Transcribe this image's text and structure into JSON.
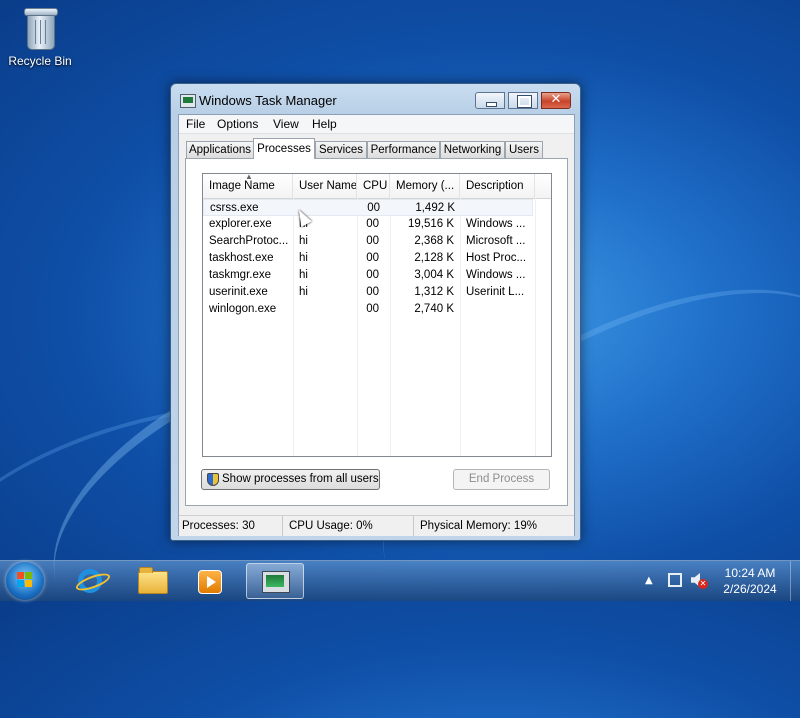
{
  "desktop": {
    "icons": [
      {
        "label": "Recycle Bin",
        "icon": "recycle-bin-icon"
      }
    ]
  },
  "window": {
    "title": "Windows Task Manager",
    "menu": [
      "File",
      "Options",
      "View",
      "Help"
    ],
    "tabs": [
      "Applications",
      "Processes",
      "Services",
      "Performance",
      "Networking",
      "Users"
    ],
    "active_tab": "Processes",
    "process_table": {
      "columns": [
        "Image Name",
        "User Name",
        "CPU",
        "Memory (...",
        "Description"
      ],
      "rows": [
        {
          "name": "csrss.exe",
          "user": "",
          "cpu": "00",
          "mem": "1,492 K",
          "desc": ""
        },
        {
          "name": "explorer.exe",
          "user": "hi",
          "cpu": "00",
          "mem": "19,516 K",
          "desc": "Windows ..."
        },
        {
          "name": "SearchProtoc...",
          "user": "hi",
          "cpu": "00",
          "mem": "2,368 K",
          "desc": "Microsoft ..."
        },
        {
          "name": "taskhost.exe",
          "user": "hi",
          "cpu": "00",
          "mem": "2,128 K",
          "desc": "Host Proc..."
        },
        {
          "name": "taskmgr.exe",
          "user": "hi",
          "cpu": "00",
          "mem": "3,004 K",
          "desc": "Windows ..."
        },
        {
          "name": "userinit.exe",
          "user": "hi",
          "cpu": "00",
          "mem": "1,312 K",
          "desc": "Userinit L..."
        },
        {
          "name": "winlogon.exe",
          "user": "",
          "cpu": "00",
          "mem": "2,740 K",
          "desc": ""
        }
      ]
    },
    "buttons": {
      "show_all_users": "Show processes from all users",
      "end_process": "End Process"
    },
    "status": {
      "processes": "Processes: 30",
      "cpu": "CPU Usage: 0%",
      "memory": "Physical Memory: 19%"
    }
  },
  "taskbar": {
    "items": [
      "start-button",
      "internet-explorer",
      "windows-explorer",
      "windows-media-player",
      "task-manager"
    ],
    "clock": {
      "time": "10:24 AM",
      "date": "2/26/2024"
    }
  }
}
